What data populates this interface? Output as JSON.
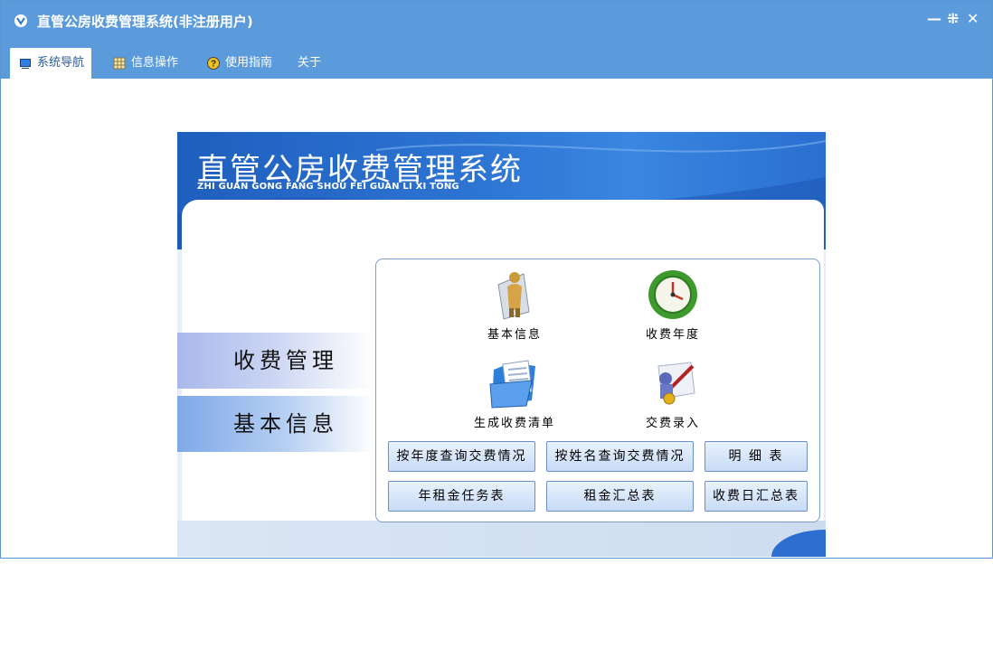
{
  "window": {
    "title": "直管公房收费管理系统(非注册用户)",
    "controls": {
      "minimize": "—",
      "restore": "⁜",
      "close": "✕"
    }
  },
  "menu": {
    "items": [
      {
        "label": "系统导航",
        "icon": "monitor-icon",
        "active": true
      },
      {
        "label": "信息操作",
        "icon": "grid-icon",
        "active": false
      },
      {
        "label": "使用指南",
        "icon": "help-icon",
        "active": false
      },
      {
        "label": "关于",
        "icon": "",
        "active": false
      }
    ]
  },
  "banner": {
    "title": "直管公房收费管理系统",
    "subtitle": "ZHI GUAN GONG FANG SHOU FEI GUAN LI XI TONG"
  },
  "sidebar": {
    "tabs": [
      {
        "label": "收费管理",
        "selected": true
      },
      {
        "label": "基本信息",
        "selected": false
      }
    ]
  },
  "functions": {
    "items": [
      {
        "label": "基本信息",
        "icon": "person-info-icon"
      },
      {
        "label": "收费年度",
        "icon": "clock-icon"
      },
      {
        "label": "生成收费清单",
        "icon": "document-folder-icon"
      },
      {
        "label": "交费录入",
        "icon": "payment-entry-icon"
      }
    ],
    "buttons": [
      "按年度查询交费情况",
      "按姓名查询交费情况",
      "明 细 表",
      "年租金任务表",
      "租金汇总表",
      "收费日汇总表"
    ]
  },
  "colors": {
    "titlebar": "#5b9bdc",
    "banner": "#2d74d2",
    "button_border": "#6b90c8"
  }
}
